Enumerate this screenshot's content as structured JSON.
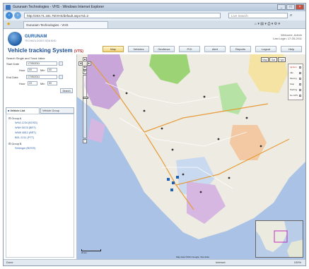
{
  "window": {
    "title": "Gurunam Technologies - VHS - Windows Internet Explorer"
  },
  "browser": {
    "url": "http://203.71.181.75/VHS/default.aspx?id=2",
    "search_placeholder": "Live Search",
    "tab_label": "Gurunam Technologies - VHS"
  },
  "header": {
    "brand": "GURUNAM",
    "brand_sub": "TECHNOLOGIES SDN BHD",
    "app_title": "Vehicle tracking System",
    "app_badge": "(VTS)",
    "user_line1": "Welcome, Admin",
    "user_line2": "Last Login: 17-05-2011"
  },
  "menu": [
    {
      "label": "Map"
    },
    {
      "label": "Vehicles"
    },
    {
      "label": "Geofence"
    },
    {
      "label": "POI"
    },
    {
      "label": "Alert"
    },
    {
      "label": "Reports"
    },
    {
      "label": "Logout"
    },
    {
      "label": "Help"
    }
  ],
  "sidebar": {
    "search_label": "Search Single and Track Value",
    "start_label": "Start Date",
    "start_value": "17/05/2011",
    "end_label": "End Date",
    "end_value": "17/05/2011",
    "hour_label": "Hour",
    "min_label": "Min",
    "hour1": "00",
    "min1": "00",
    "hour2": "23",
    "min2": "59",
    "search_button": "Search",
    "tab1": "Vehicle List",
    "tab2": "Vehicle Group",
    "tree": [
      {
        "group": "Group A",
        "items": [
          "WKA 1234 (BOSS)",
          "WNH 5678 (BRT)",
          "WMK 8812 (BRT)",
          "BDL 2211 (PTT)"
        ]
      },
      {
        "group": "Group B",
        "items": [
          "Selangor (BOSS)"
        ]
      }
    ]
  },
  "map": {
    "type_buttons": [
      "Map",
      "Sat",
      "Hyb"
    ],
    "legend": [
      "Ignition",
      "Idle",
      "Moving",
      "Stop",
      "Parking",
      "No GPS"
    ],
    "scale_text": "20 km",
    "copyright": "Map data ©2011 Google, Tele Atlas"
  },
  "status": {
    "left": "Done",
    "right": "Internet",
    "zoom": "100%"
  },
  "colors": {
    "accent": "#1f5fa8",
    "active_menu": "#f2d37a"
  }
}
